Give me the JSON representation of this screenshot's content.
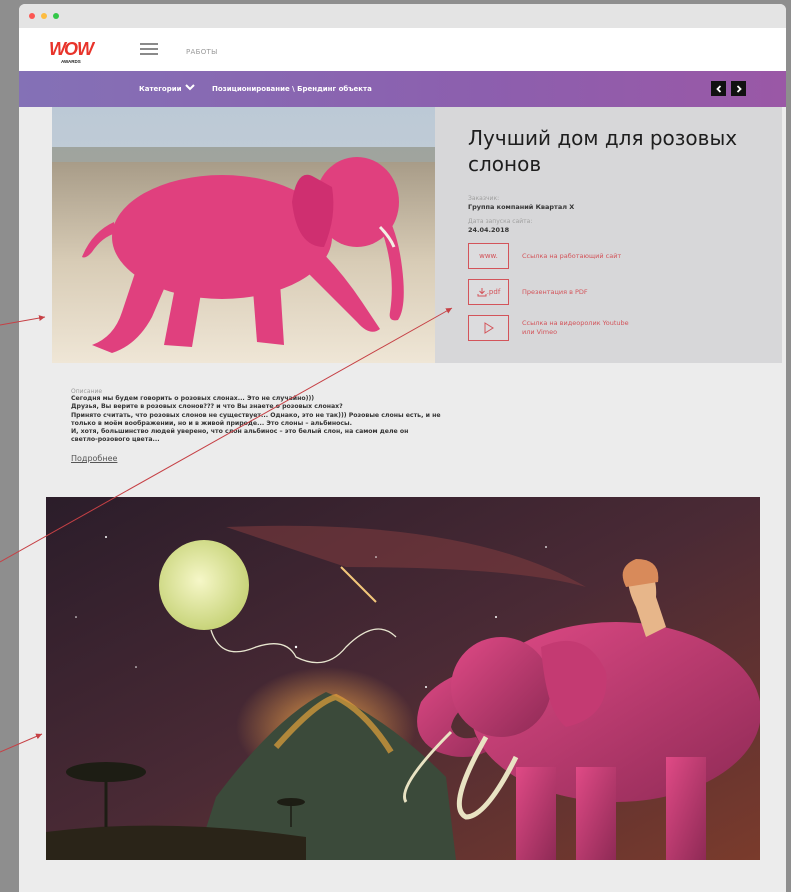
{
  "header": {
    "logo_text": "WOW",
    "logo_sub": "AWARDS",
    "nav_link": "РАБОТЫ"
  },
  "category_bar": {
    "label": "Категории",
    "path": "Позиционирование \\ Брендинг объекта",
    "prev_icon": "chevron-left-icon",
    "next_icon": "chevron-right-icon"
  },
  "project": {
    "title": "Лучший дом для розовых слонов",
    "client_label": "Заказчик:",
    "client_value": "Группа компаний Квартал Х",
    "date_label": "Дата запуска сайта:",
    "date_value": "24.04.2018",
    "links": [
      {
        "box_label": "www.",
        "text": "Ссылка на работающий сайт"
      },
      {
        "box_label": ".pdf",
        "text": "Презентация в PDF"
      },
      {
        "box_label": "",
        "text_line1": "Ссылка на видеоролик Youtube",
        "text_line2": "или Vimeo"
      }
    ]
  },
  "description": {
    "label": "Описание",
    "lines": [
      "Сегодня мы будем говорить о розовых слонах... Это не случайно)))",
      "Друзья,  Вы верите в розовых слонов??? и что Вы знаете о розовых слонах?",
      "Принято считать, что розовых слонов не существует... Однако, это не так))) Розовые слоны есть, и не",
      "только в моём воображении, но и в живой природе... Это слоны – альбиносы.",
      "И, хотя, большинство людей уверено, что слон альбинос – это белый слон, на самом деле он",
      "светло-розового цвета..."
    ],
    "more": "Подробнее"
  },
  "colors": {
    "accent": "#d3545a",
    "bar_start": "#8471b6",
    "bar_end": "#9a58a6",
    "elephant_pink": "#e0407e"
  }
}
